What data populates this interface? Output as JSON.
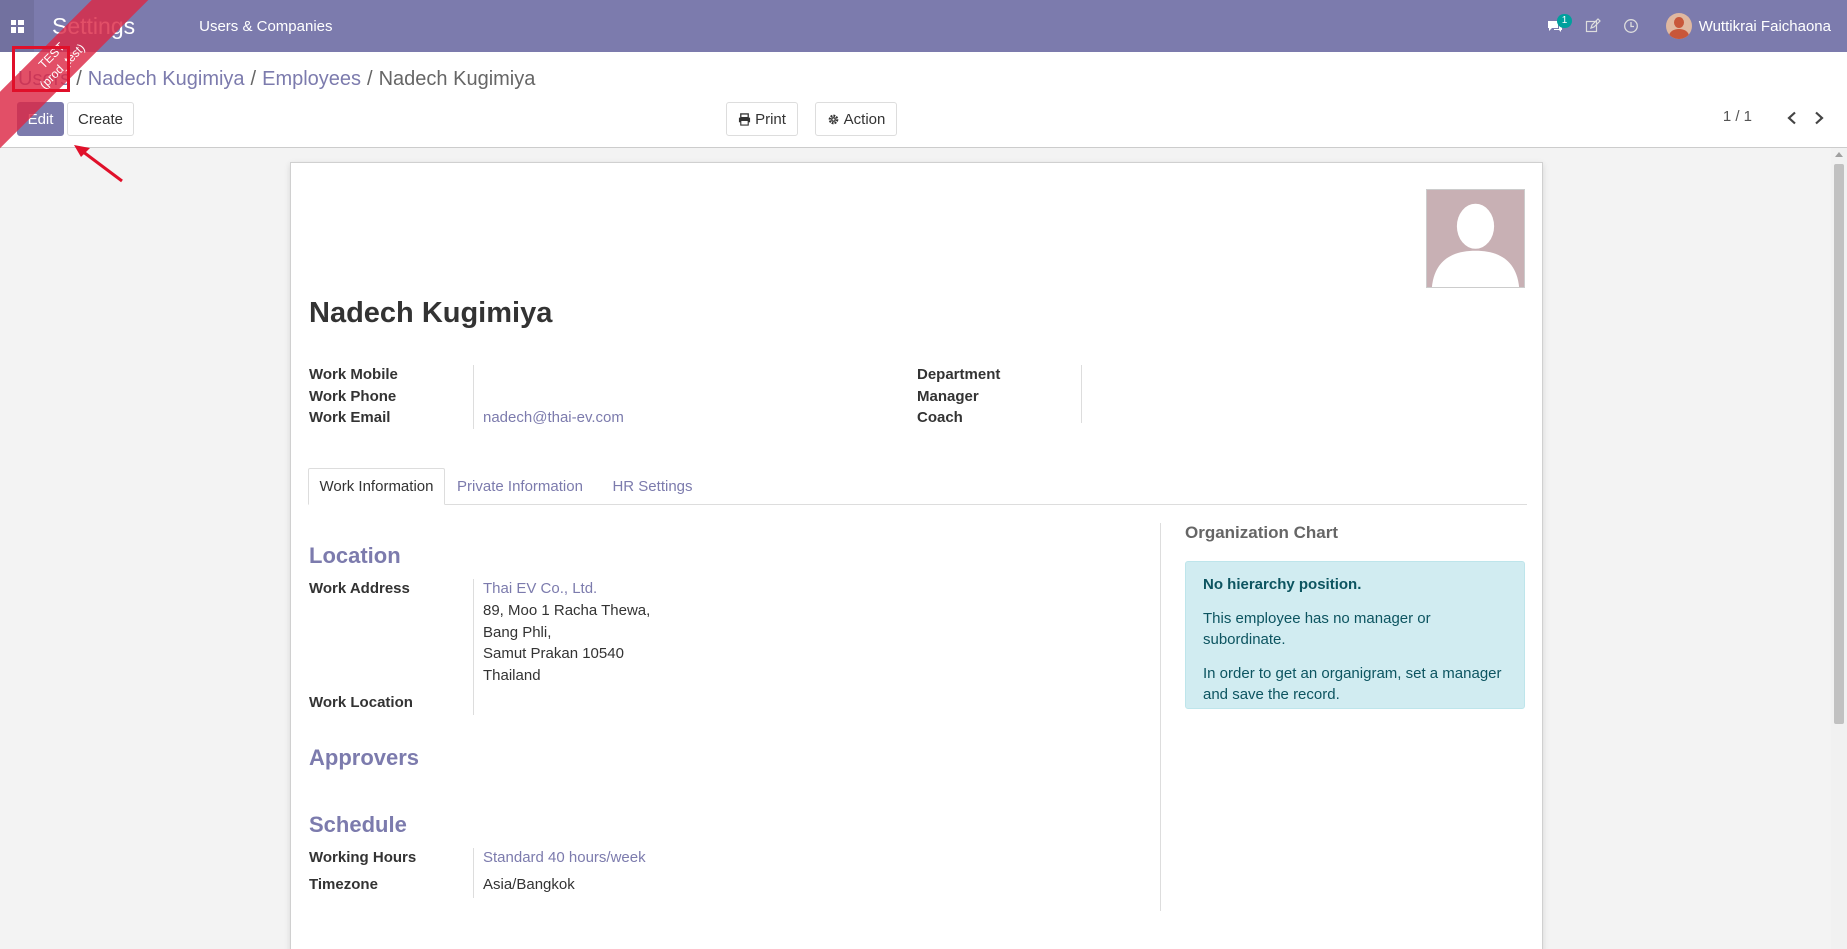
{
  "navbar": {
    "app_name": "Settings",
    "menu_items": [
      "Users & Companies"
    ],
    "message_count": "1",
    "user_name": "Wuttikrai Faichaona"
  },
  "ribbon": {
    "line1": "TEST",
    "line2": "(prod_test)"
  },
  "breadcrumb": {
    "items": [
      "Users",
      "Nadech Kugimiya",
      "Employees"
    ],
    "current": "Nadech Kugimiya"
  },
  "toolbar": {
    "edit_label": "Edit",
    "create_label": "Create",
    "print_label": "Print",
    "action_label": "Action",
    "pager": "1 / 1"
  },
  "employee": {
    "name": "Nadech Kugimiya",
    "left_fields": [
      {
        "label": "Work Mobile",
        "value": ""
      },
      {
        "label": "Work Phone",
        "value": ""
      },
      {
        "label": "Work Email",
        "value": "nadech@thai-ev.com"
      }
    ],
    "right_fields": [
      {
        "label": "Department",
        "value": ""
      },
      {
        "label": "Manager",
        "value": ""
      },
      {
        "label": "Coach",
        "value": ""
      }
    ]
  },
  "tabs": [
    "Work Information",
    "Private Information",
    "HR Settings"
  ],
  "work_info": {
    "location_title": "Location",
    "work_address_label": "Work Address",
    "work_address_company": "Thai EV Co., Ltd.",
    "work_address_lines": [
      "89, Moo 1 Racha Thewa,",
      "Bang Phli,",
      "Samut Prakan 10540",
      "Thailand"
    ],
    "work_location_label": "Work Location",
    "work_location_value": "",
    "approvers_title": "Approvers",
    "schedule_title": "Schedule",
    "working_hours_label": "Working Hours",
    "working_hours_value": "Standard 40 hours/week",
    "timezone_label": "Timezone",
    "timezone_value": "Asia/Bangkok"
  },
  "org_chart": {
    "title": "Organization Chart",
    "heading": "No hierarchy position.",
    "line1": "This employee has no manager or subordinate.",
    "line2": "In order to get an organigram, set a manager and save the record."
  },
  "colors": {
    "brand": "#7c7bad",
    "highlight": "#e0102a",
    "info_bg": "#d1ecf1"
  }
}
